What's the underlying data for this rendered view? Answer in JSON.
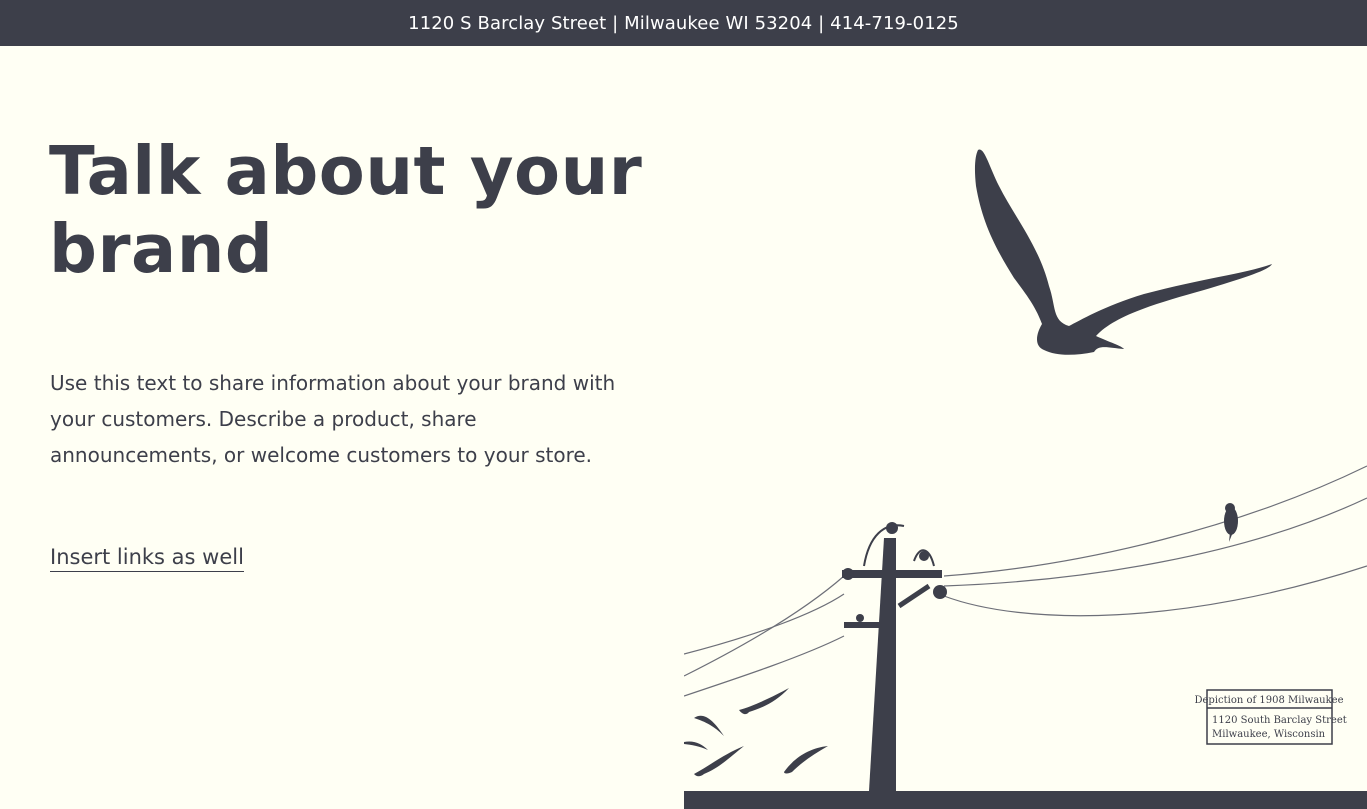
{
  "topbar": {
    "text": "1120 S Barclay Street | Milwaukee WI 53204 | 414-719-0125"
  },
  "hero": {
    "title": "Talk about your brand",
    "text": "Use this text to share information about your brand with your customers. Describe a product, share announcements, or welcome customers to your store.",
    "link": "Insert links as well"
  },
  "illustration": {
    "plaque_title": "Depiction of 1908 Milwaukee",
    "plaque_line1": "1120 South Barclay Street",
    "plaque_line2": "Milwaukee, Wisconsin"
  },
  "icons": {
    "menu": "hamburger-menu-icon"
  },
  "colors": {
    "dark": "#3d3f4a",
    "background": "#fffff4",
    "text_light": "#ffffff"
  }
}
